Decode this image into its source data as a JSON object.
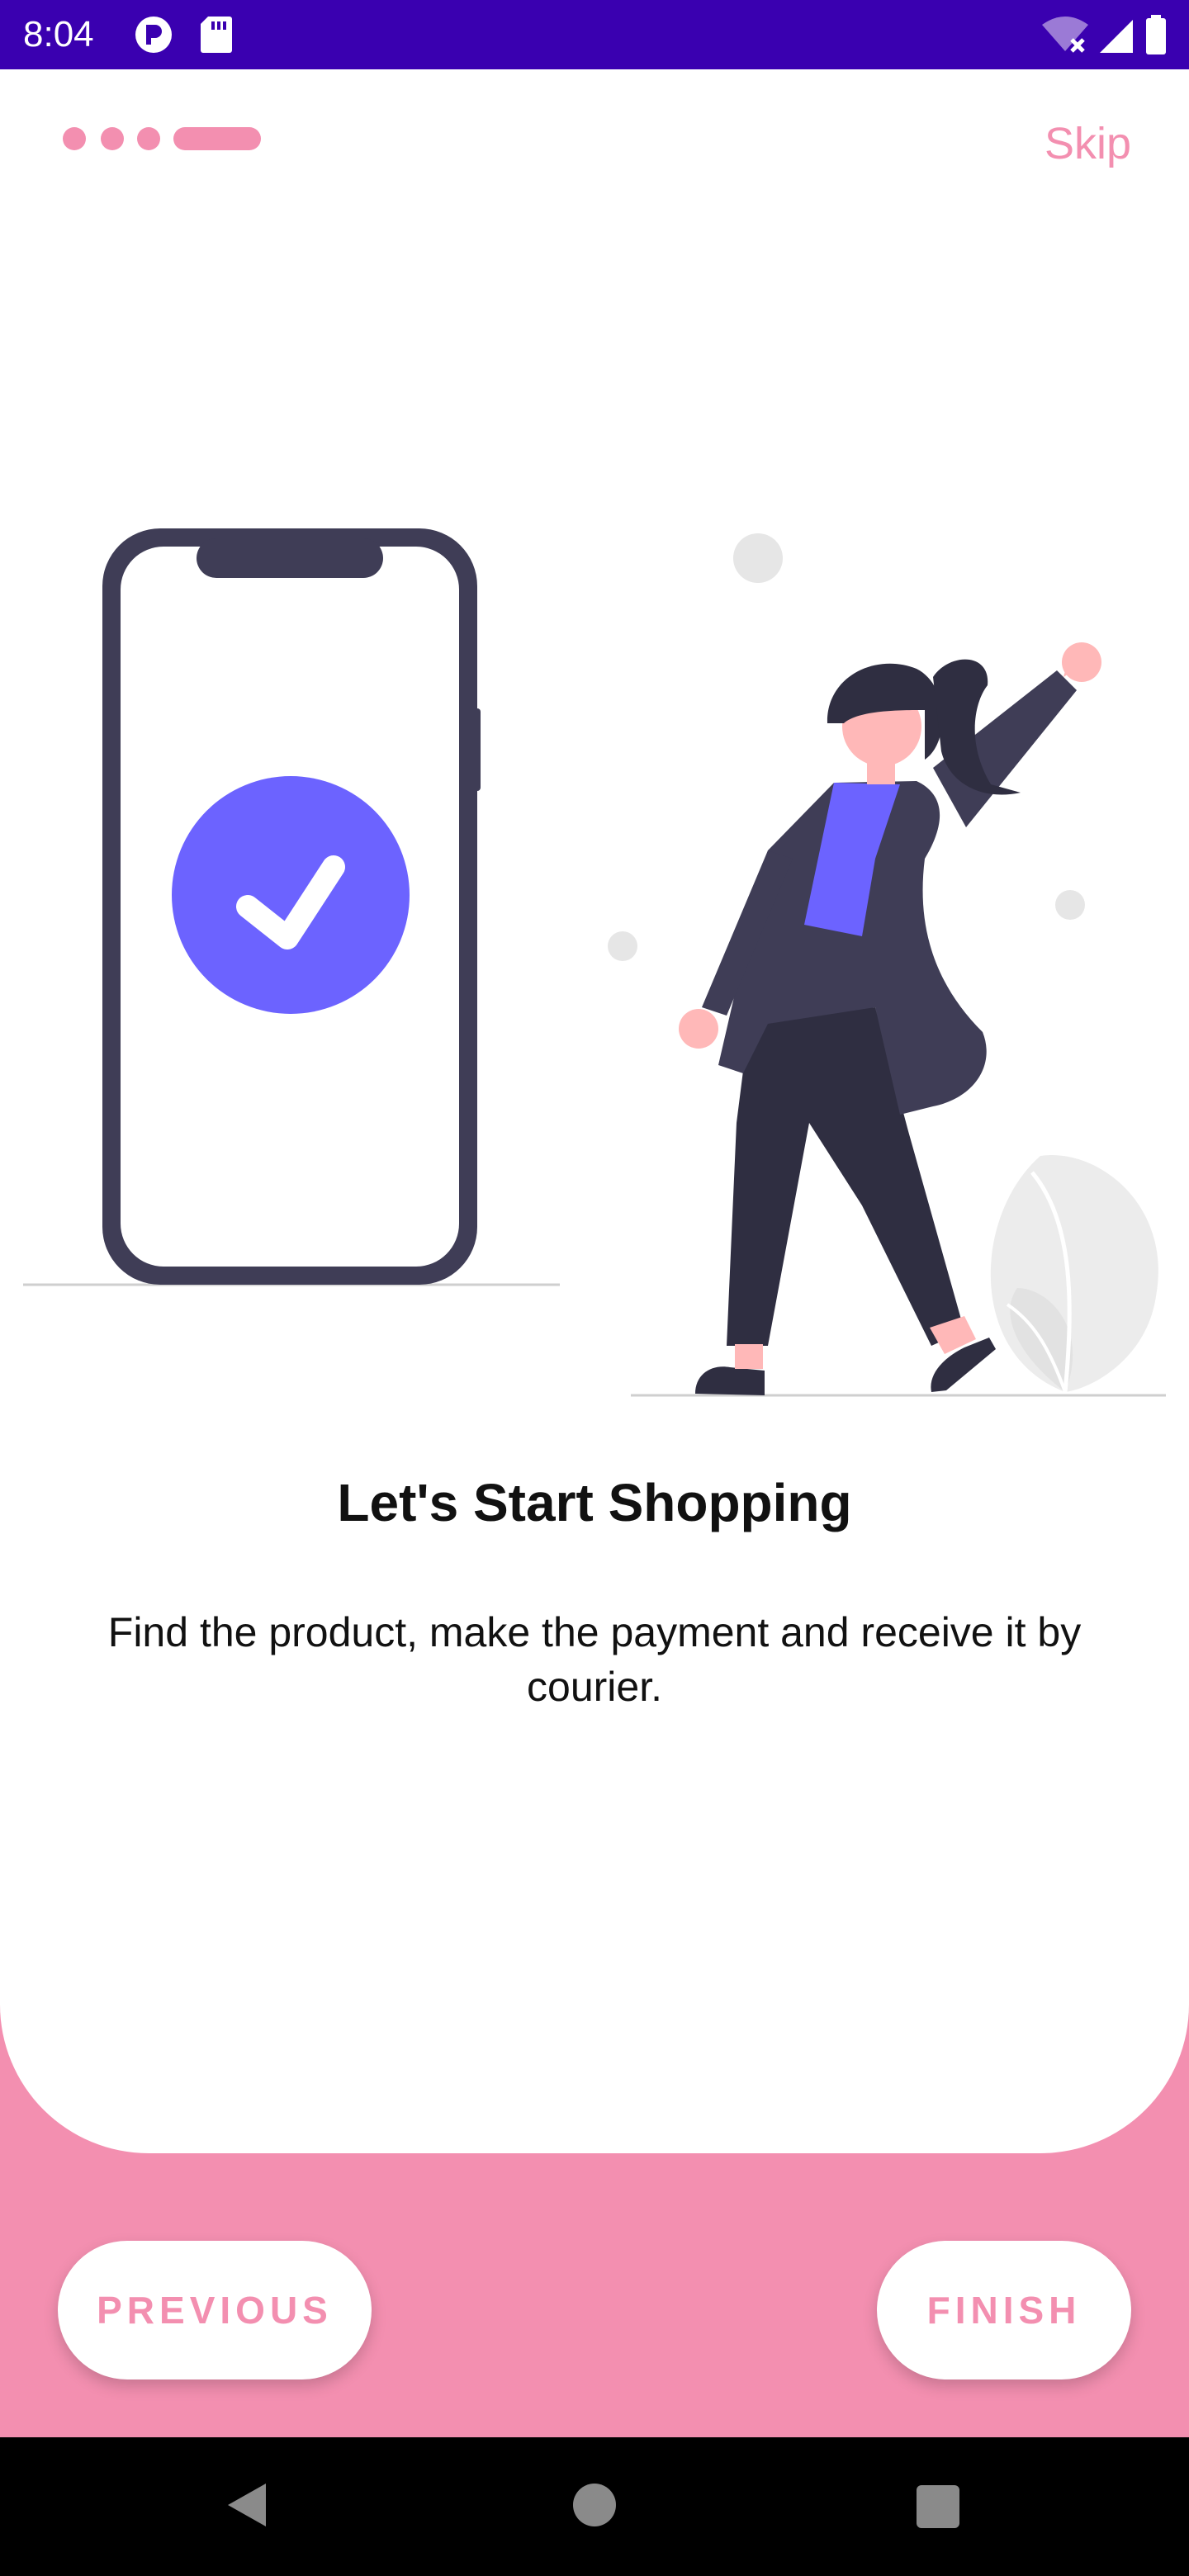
{
  "status_bar": {
    "time": "8:04",
    "icons_left": [
      "p-circle-icon",
      "sd-card-icon"
    ],
    "icons_right": [
      "wifi-off-icon",
      "signal-icon",
      "battery-icon"
    ]
  },
  "onboarding": {
    "page_indicator": {
      "total": 4,
      "current": 4
    },
    "skip_label": "Skip",
    "title": "Let's Start Shopping",
    "description": "Find the product, make the payment and receive it by courier.",
    "previous_label": "PREVIOUS",
    "finish_label": "FINISH"
  },
  "colors": {
    "accent_pink": "#f38fb0",
    "status_bar": "#3a00b0",
    "check_purple": "#6c63ff",
    "dark_navy": "#3f3d56"
  },
  "nav_bar": {
    "icons": [
      "back-icon",
      "home-icon",
      "recents-icon"
    ]
  }
}
